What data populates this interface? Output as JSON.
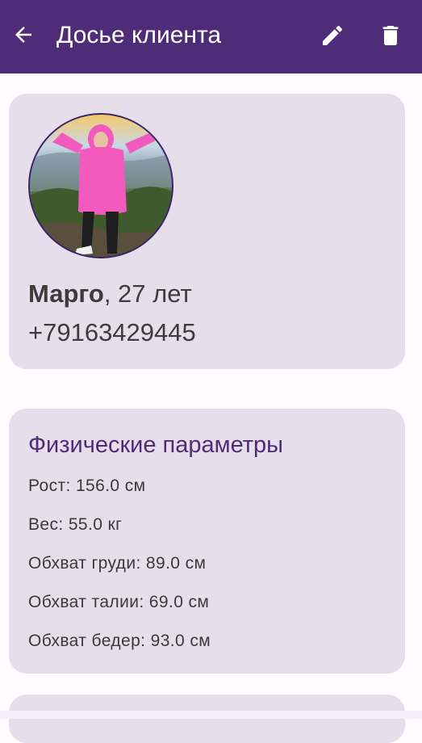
{
  "app_bar": {
    "title": "Досье клиента",
    "back_icon": "arrow-left-icon",
    "edit_icon": "pencil-icon",
    "delete_icon": "trash-icon",
    "background_color": "#4f2c78"
  },
  "profile": {
    "name": "Марго",
    "age": ", 27 лет",
    "phone": "+79163429445",
    "photo": "client-photo"
  },
  "physical_params": {
    "title": "Физические параметры",
    "items": [
      "Рост: 156.0 см",
      "Вес: 55.0 кг",
      "Обхват груди: 89.0 см",
      "Обхват талии: 69.0 см",
      "Обхват бедер: 93.0 см"
    ]
  },
  "colors": {
    "card_background": "#e7deeb",
    "accent": "#4f2c78"
  }
}
